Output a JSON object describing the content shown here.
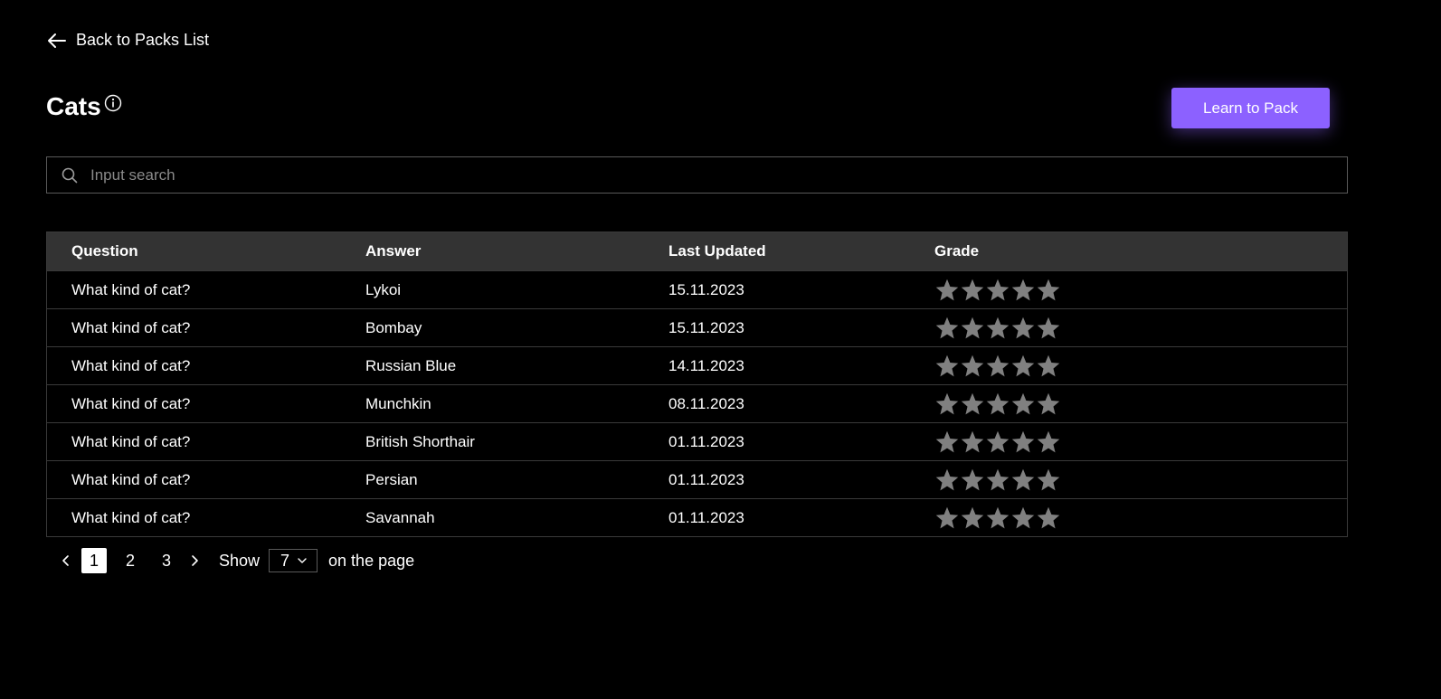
{
  "nav": {
    "back_label": "Back to Packs List",
    "back_icon": "arrow-left-icon"
  },
  "pack": {
    "title": "Cats",
    "info_icon": "info-circle-icon"
  },
  "actions": {
    "learn_label": "Learn to Pack",
    "accent_color": "#8c61ff"
  },
  "search": {
    "placeholder": "Input search",
    "value": "",
    "icon": "search-icon"
  },
  "table": {
    "headers": {
      "question": "Question",
      "answer": "Answer",
      "updated": "Last Updated",
      "grade": "Grade"
    },
    "rows": [
      {
        "question": "What kind of cat?",
        "answer": "Lykoi",
        "updated": "15.11.2023",
        "grade": 0,
        "max_grade": 5
      },
      {
        "question": "What kind of cat?",
        "answer": "Bombay",
        "updated": "15.11.2023",
        "grade": 0,
        "max_grade": 5
      },
      {
        "question": "What kind of cat?",
        "answer": "Russian Blue",
        "updated": "14.11.2023",
        "grade": 0,
        "max_grade": 5
      },
      {
        "question": "What kind of cat?",
        "answer": "Munchkin",
        "updated": "08.11.2023",
        "grade": 0,
        "max_grade": 5
      },
      {
        "question": "What kind of cat?",
        "answer": "British Shorthair",
        "updated": "01.11.2023",
        "grade": 0,
        "max_grade": 5
      },
      {
        "question": "What kind of cat?",
        "answer": "Persian",
        "updated": "01.11.2023",
        "grade": 0,
        "max_grade": 5
      },
      {
        "question": "What kind of cat?",
        "answer": "Savannah",
        "updated": "01.11.2023",
        "grade": 0,
        "max_grade": 5
      }
    ],
    "star_empty_color": "#808080",
    "star_filled_color": "#ffc107"
  },
  "pagination": {
    "prev_icon": "chevron-left-icon",
    "next_icon": "chevron-right-icon",
    "pages": [
      "1",
      "2",
      "3"
    ],
    "current": "1",
    "show_label": "Show",
    "per_page": "7",
    "per_page_icon": "chevron-down-icon",
    "suffix": "on the page"
  }
}
